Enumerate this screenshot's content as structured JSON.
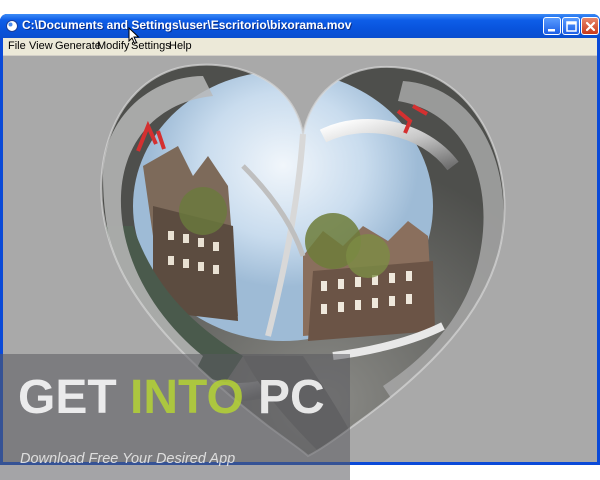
{
  "window": {
    "title": "C:\\Documents and Settings\\user\\Escritorio\\bixorama.mov",
    "controls": [
      "minimize-icon",
      "maximize-icon",
      "close-icon"
    ]
  },
  "menu": {
    "items": [
      {
        "label": "File"
      },
      {
        "label": "View"
      },
      {
        "label": "Generate"
      },
      {
        "label": "Modify"
      },
      {
        "label": "Settings"
      },
      {
        "label": "Help"
      }
    ]
  },
  "viewport": {
    "content": "heart-shaped panoramic street photo",
    "background_color": "#a9a9a9"
  },
  "watermark": {
    "text_get": "GET",
    "text_into": "INTO",
    "text_pc": "PC",
    "tagline": "Download Free Your Desired App",
    "accent_color": "#b5d334"
  },
  "colors": {
    "titlebar": "#0a56e0",
    "menubar": "#ece9d8",
    "close_button": "#d9502f"
  }
}
